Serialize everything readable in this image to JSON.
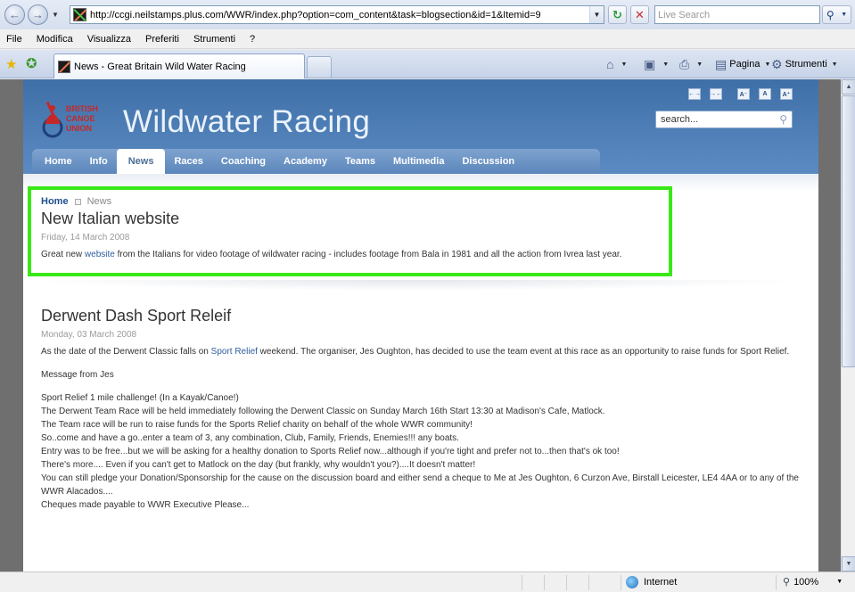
{
  "browser": {
    "url": "http://ccgi.neilstamps.plus.com/WWR/index.php?option=com_content&task=blogsection&id=1&Itemid=9",
    "search_placeholder": "Live Search",
    "menu": [
      "File",
      "Modifica",
      "Visualizza",
      "Preferiti",
      "Strumenti",
      "?"
    ],
    "tab_title": "News - Great Britain Wild Water Racing",
    "cmd": {
      "page": "Pagina",
      "tools": "Strumenti"
    },
    "status": {
      "zone": "Internet",
      "zoom": "100%"
    }
  },
  "site": {
    "title": "Wildwater Racing",
    "logo": [
      "BRITISH",
      "CANOE",
      "UNION"
    ],
    "font_buttons": [
      "←→",
      "→←",
      "A⁻",
      "A",
      "A⁺"
    ],
    "search_value": "search...",
    "nav": [
      {
        "label": "Home",
        "active": false
      },
      {
        "label": "Info",
        "active": false
      },
      {
        "label": "News",
        "active": true
      },
      {
        "label": "Races",
        "active": false
      },
      {
        "label": "Coaching",
        "active": false
      },
      {
        "label": "Academy",
        "active": false
      },
      {
        "label": "Teams",
        "active": false
      },
      {
        "label": "Multimedia",
        "active": false
      },
      {
        "label": "Discussion",
        "active": false
      }
    ]
  },
  "breadcrumb": {
    "home": "Home",
    "current": "News"
  },
  "article1": {
    "title": "New Italian website",
    "date": "Friday, 14 March 2008",
    "body_pre": "Great new ",
    "body_link": "website",
    "body_post": " from the Italians for video footage of wildwater racing - includes footage from Bala in 1981 and all the action from Ivrea last year."
  },
  "article2": {
    "title": "Derwent Dash Sport Releif",
    "date": "Monday, 03 March 2008",
    "intro_pre": "As the date of the Derwent Classic falls on ",
    "intro_link": "Sport Relief",
    "intro_post": " weekend. The organiser, Jes Oughton, has decided to use the team event at this race as an opportunity to raise funds for Sport Relief.",
    "message_from": "Message from Jes",
    "lines": [
      "Sport Relief 1 mile challenge! (In a Kayak/Canoe!)",
      "The Derwent Team Race will be held immediately following the Derwent Classic on Sunday March 16th Start 13:30 at Madison's Cafe, Matlock.",
      "The Team race will be run to raise funds for the Sports Relief charity on behalf of the whole WWR community!",
      "So..come and have a go..enter a team of 3, any combination, Club, Family, Friends, Enemies!!! any boats.",
      "Entry was to be free...but we will be asking for a healthy donation to Sports Relief now...although if you're tight and prefer not to...then that's ok too!",
      "There's more.... Even if you can't get to Matlock on the day (but frankly, why wouldn't you?)....It doesn't matter!",
      "You can still pledge your Donation/Sponsorship for the cause on the discussion board and either send a cheque to Me at Jes Oughton, 6 Curzon Ave, Birstall Leicester, LE4 4AA or to any of the WWR Alacados....",
      "Cheques made payable to WWR Executive Please..."
    ]
  },
  "colors": {
    "header_blue": "#4a7bb5",
    "highlight": "#39e817",
    "link": "#2e5e9e"
  }
}
